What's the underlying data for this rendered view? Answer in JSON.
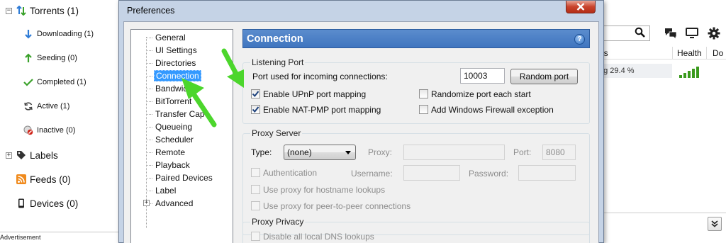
{
  "sidebar": {
    "torrents": "Torrents (1)",
    "downloading": "Downloading (1)",
    "seeding": "Seeding (0)",
    "completed": "Completed (1)",
    "active": "Active (1)",
    "inactive": "Inactive (0)",
    "labels": "Labels",
    "feeds": "Feeds (0)",
    "devices": "Devices (0)",
    "advertisement": "Advertisement"
  },
  "background": {
    "col_status_partial": "us",
    "col_health": "Health",
    "col_down_partial": "Do",
    "status_partial": "ng 29.4 %",
    "health_level": 5
  },
  "dialog": {
    "title": "Preferences",
    "tree": {
      "items": [
        "General",
        "UI Settings",
        "Directories",
        "Connection",
        "Bandwidth",
        "BitTorrent",
        "Transfer Cap",
        "Queueing",
        "Scheduler",
        "Remote",
        "Playback",
        "Paired Devices",
        "Label",
        "Advanced"
      ],
      "selected": "Connection"
    },
    "section_title": "Connection",
    "help": "?",
    "listening": {
      "title": "Listening Port",
      "port_label": "Port used for incoming connections:",
      "port_value": "10003",
      "random_port": "Random port",
      "upnp": "Enable UPnP port mapping",
      "natpmp": "Enable NAT-PMP port mapping",
      "randomize": "Randomize port each start",
      "firewall": "Add Windows Firewall exception"
    },
    "proxy": {
      "title": "Proxy Server",
      "type_label": "Type:",
      "type_value": "(none)",
      "proxy_label": "Proxy:",
      "port_label": "Port:",
      "port_value": "8080",
      "auth": "Authentication",
      "username": "Username:",
      "password": "Password:",
      "hostname": "Use proxy for hostname lookups",
      "p2p": "Use proxy for peer-to-peer connections"
    },
    "privacy": {
      "title": "Proxy Privacy",
      "dns": "Disable all local DNS lookups"
    }
  },
  "colors": {
    "header_blue": "#4a80c8",
    "selection_blue": "#3399ff",
    "arrow_green": "#4cd62c",
    "health_green": "#3a9a1c"
  }
}
